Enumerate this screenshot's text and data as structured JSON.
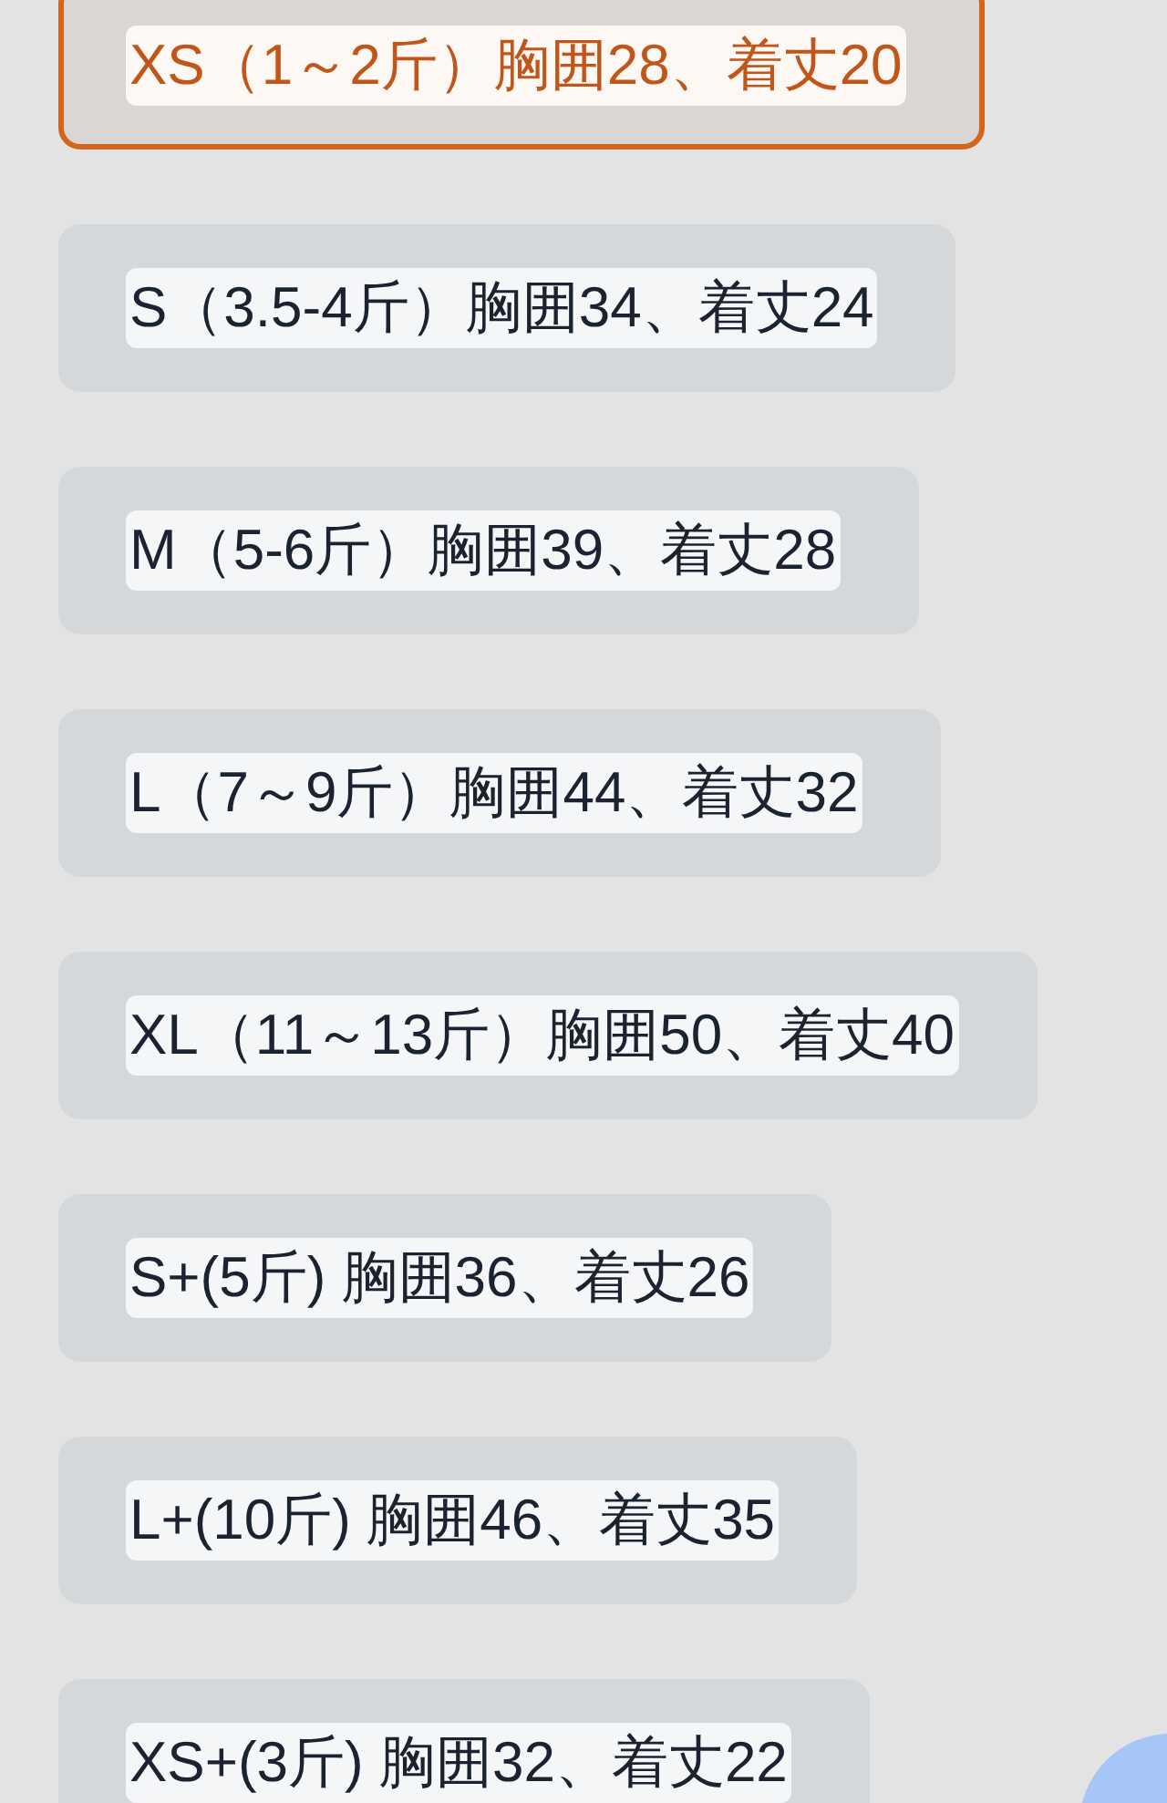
{
  "size_options": [
    {
      "label": "XS（1～2斤）胸囲28、着丈20",
      "selected": true
    },
    {
      "label": "S（3.5-4斤）胸囲34、着丈24",
      "selected": false
    },
    {
      "label": "M（5-6斤）胸囲39、着丈28",
      "selected": false
    },
    {
      "label": "L（7～9斤）胸囲44、着丈32",
      "selected": false
    },
    {
      "label": "XL（11～13斤）胸囲50、着丈40",
      "selected": false
    },
    {
      "label": "S+(5斤) 胸囲36、着丈26",
      "selected": false
    },
    {
      "label": "L+(10斤) 胸囲46、着丈35",
      "selected": false
    },
    {
      "label": "XS+(3斤) 胸囲32、着丈22",
      "selected": false
    }
  ]
}
